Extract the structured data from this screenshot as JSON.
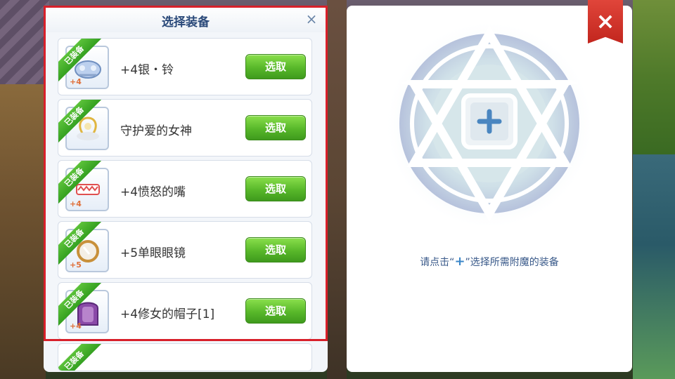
{
  "left_panel": {
    "title": "选择装备",
    "close_icon": "×",
    "items": [
      {
        "name": "+4银・铃",
        "badge": "已装备",
        "refine": "+4",
        "button": "选取",
        "icon": "silver-bell-icon"
      },
      {
        "name": "守护爱的女神",
        "badge": "已装备",
        "refine": "",
        "button": "选取",
        "icon": "goddess-icon"
      },
      {
        "name": "+4愤怒的嘴",
        "badge": "已装备",
        "refine": "+4",
        "button": "选取",
        "icon": "angry-mouth-icon"
      },
      {
        "name": "+5单眼眼镜",
        "badge": "已装备",
        "refine": "+5",
        "button": "选取",
        "icon": "monocle-icon"
      },
      {
        "name": "+4修女的帽子[1]",
        "badge": "已装备",
        "refine": "+4",
        "button": "选取",
        "icon": "nun-hat-icon"
      }
    ],
    "partial_item": {
      "badge": "已装备"
    }
  },
  "right_panel": {
    "hint_prefix": "请点击“",
    "hint_plus": "+",
    "hint_suffix": "”选择所需附魔的装备",
    "close_label": "×"
  },
  "colors": {
    "accent_green": "#58b82a",
    "title_blue": "#2b4a7a",
    "close_red": "#c2261e",
    "highlight_red": "#d8202a"
  }
}
